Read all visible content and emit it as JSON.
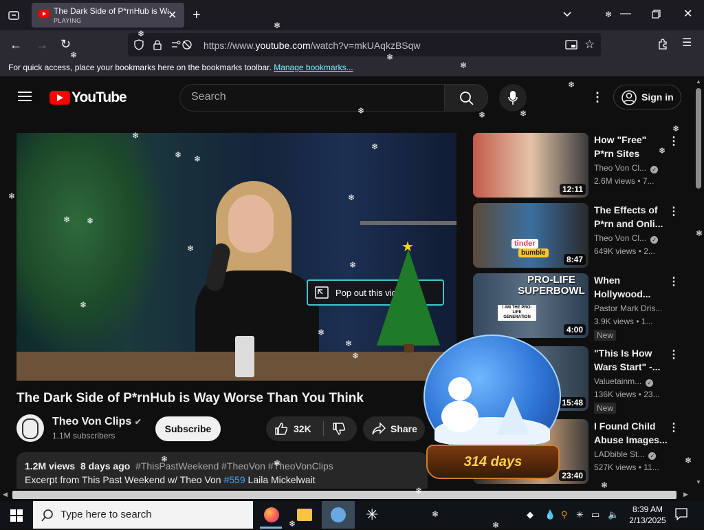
{
  "browser": {
    "tab_title": "The Dark Side of P*rnHub is Wa",
    "tab_status": "PLAYING",
    "url_prefix": "https://www.",
    "url_domain": "youtube.com",
    "url_path": "/watch?v=mkUAqkzBSqw",
    "bookmarks_text": "For quick access, place your bookmarks here on the bookmarks toolbar.",
    "bookmarks_link": "Manage bookmarks..."
  },
  "youtube": {
    "logo": "YouTube",
    "search_placeholder": "Search",
    "sign_in": "Sign in",
    "popout_label": "Pop out this video",
    "video_title": "The Dark Side of P*rnHub is Way Worse Than You Think",
    "channel_name": "Theo Von Clips",
    "subscribers": "1.1M subscribers",
    "subscribe": "Subscribe",
    "likes": "32K",
    "share": "Share",
    "views": "1.2M views",
    "age": "8 days ago",
    "hashtags": "#ThisPastWeekend #TheoVon #TheoVonClips",
    "desc_prefix": "Excerpt from This Past Weekend w/ Theo Von",
    "desc_link": "#559",
    "desc_suffix": "Laila Mickelwait"
  },
  "recommendations": [
    {
      "title": "How \"Free\" P*rn Sites Really...",
      "channel": "Theo Von Cl...",
      "meta": "2.6M views • 7...",
      "duration": "12:11",
      "badge": ""
    },
    {
      "title": "The Effects of P*rn and Onli...",
      "channel": "Theo Von Cl...",
      "meta": "649K views • 2...",
      "duration": "8:47",
      "badge": ""
    },
    {
      "title": "When Hollywood...",
      "channel": "Pastor Mark Dris...",
      "meta": "3.9K views • 1...",
      "duration": "4:00",
      "badge": "New"
    },
    {
      "title": "\"This Is How Wars Start\" -...",
      "channel": "Valuetainm...",
      "meta": "136K views • 23...",
      "duration": "15:48",
      "badge": "New"
    },
    {
      "title": "I Found Child Abuse Images...",
      "channel": "LADbible St...",
      "meta": "527K views • 11...",
      "duration": "23:40",
      "badge": ""
    }
  ],
  "thumb_texts": {
    "rec1": "PRO-LIFE SUPERBOWL",
    "rec1_sign": "I AM THE PRO-LIFE GENERATION",
    "rec2": "tinder",
    "rec2b": "bumble"
  },
  "overlay": {
    "globe_days": "314 days"
  },
  "taskbar": {
    "search_placeholder": "Type here to search",
    "time": "8:39 AM",
    "date": "2/13/2025"
  },
  "colors": {
    "yt_red": "#ff0000",
    "link_blue": "#3ea6ff",
    "bookmark_link": "#80ebff",
    "popout_border": "#3ec7d0"
  },
  "icons": [
    "tab-list-icon",
    "new-tab-icon",
    "chevron-down-icon",
    "minimize-icon",
    "maximize-icon",
    "close-window-icon",
    "back-icon",
    "forward-icon",
    "reload-icon",
    "shield-icon",
    "lock-icon",
    "permissions-icon",
    "pip-icon",
    "bookmark-star-icon",
    "extensions-icon",
    "menu-icon",
    "hamburger-icon",
    "search-icon",
    "mic-icon",
    "more-vert-icon",
    "account-icon",
    "like-icon",
    "dislike-icon",
    "share-icon",
    "windows-start-icon",
    "firefox-icon",
    "file-explorer-icon",
    "notification-icon"
  ]
}
